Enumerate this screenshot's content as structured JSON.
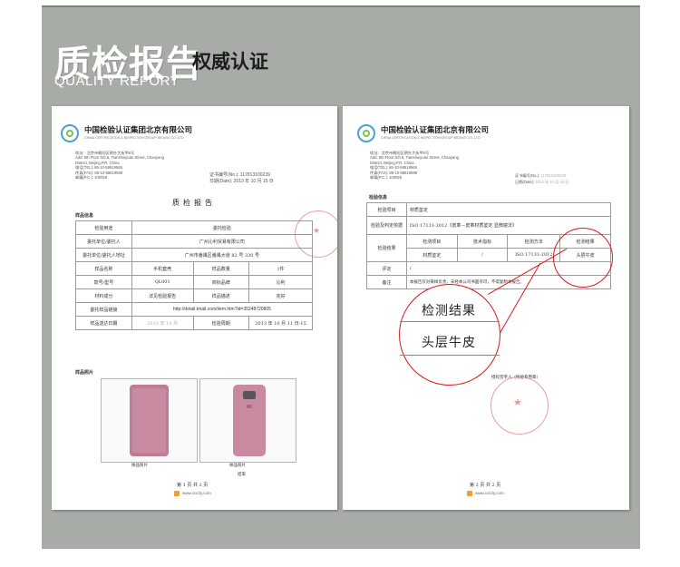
{
  "header": {
    "title_zh": "质检报告",
    "subtitle_zh": "权威认证",
    "title_en": "QUALITY REPORT"
  },
  "colors": {
    "panel_bg": "#a8aca6",
    "seal_red": "#e01818",
    "logo_blue": "#4aa3d6",
    "logo_green": "#7cbf56",
    "sample_pink": "#c98ba2"
  },
  "doc1": {
    "company": "中国检验认证集团北京有限公司",
    "company_en": "CHINA CERTIFICATION & INSPECTION GROUP BEIJING CO.,LTD",
    "address_lines": [
      "地址：北京市朝阳区朝外大街甲6号",
      "Add: 5th Floor NO.6, Tianshuiyuan Street, Chaoyang",
      "District, Beijing,P.R. China",
      "电话(TEL): 86-10-58619565",
      "传真(FAX): 86-10-58619599",
      "邮编(P.C.): 100026"
    ],
    "report_no_label": "证书编号(No.):",
    "report_no": "117813100239",
    "date_label": "日期(Date):",
    "date": "2013 年 10 月 15 日",
    "report_title": "质检报告",
    "section_sample_info": "样品信息",
    "rows": [
      {
        "label": "检验用途",
        "value": "委托检验"
      },
      {
        "label": "委托单位/委托人",
        "value": "广州沁利贸易有限公司"
      },
      {
        "label": "委托单位/委托人地址",
        "value": "广州市番禺区番禺大道 82 号 330 号"
      }
    ],
    "grid_rows": [
      [
        "样品名称",
        "手机套壳",
        "样品数量",
        "1件"
      ],
      [
        "款号/型号",
        "QL001",
        "商标品牌",
        "沁利"
      ],
      [
        "材料成分",
        "详见检验报告",
        "样品描述",
        "完好"
      ]
    ],
    "link_label": "委托样品链接",
    "link_value": "http://detail.tmall.com/item.htm?id=35248720805",
    "received_label": "样品送达日期",
    "received_value": "2013 年 10 月",
    "test_date_label": "检验周期",
    "test_date_value": "2013 年 10 月 11 日-15",
    "section_photo": "样品照片",
    "photo_caption_1": "样品照片",
    "photo_caption_2": "样品照片",
    "end_text": "结束",
    "page_text": "第 1 页 共 2 页",
    "site": "www.ccicbj.com"
  },
  "doc2": {
    "company": "中国检验认证集团北京有限公司",
    "company_en": "CHINA CERTIFICATION & INSPECTION GROUP BEIJING CO.,LTD",
    "address_lines": [
      "地址：北京市朝阳区朝外大街甲6号",
      "Add: 5th Floor NO.6, Tianshuiyuan Street, Chaoyang",
      "District, Beijing,P.R. China",
      "电话(TEL): 86-10-58619565",
      "传真(FAX): 86-10-58619599",
      "邮编(P.C.): 100026"
    ],
    "report_no_label": "证书编号(No.):",
    "report_no": "117813100239",
    "date_label": "日期(Date):",
    "date": "2013 年 10 月 15 日",
    "section_test_info": "检验信息",
    "rows": [
      {
        "label": "检验项目",
        "value": "材质鉴定"
      },
      {
        "label": "检验及判定依据",
        "value": "ISO 17131-2012《皮革－皮革材质鉴定 显微镜法》"
      }
    ],
    "result_label": "检验结果",
    "result_headers": [
      "检测项目",
      "技术指标",
      "检测方法",
      "检测结果"
    ],
    "result_row": [
      "材质鉴定",
      "/",
      "ISO 17131-2012",
      "头层牛皮"
    ],
    "remark_label": "评定",
    "remark_value": "/",
    "note_label": "备注",
    "note_value": "本报告仅对来样负责，未经本公司书面许可，不得复制本报告。",
    "zoom_result_header": "检测结果",
    "zoom_result_value": "头层牛皮",
    "signature_text": "授权签字人（检验专用章）",
    "page_text": "第 2 页 共 2 页",
    "site": "www.ccicbj.com"
  }
}
